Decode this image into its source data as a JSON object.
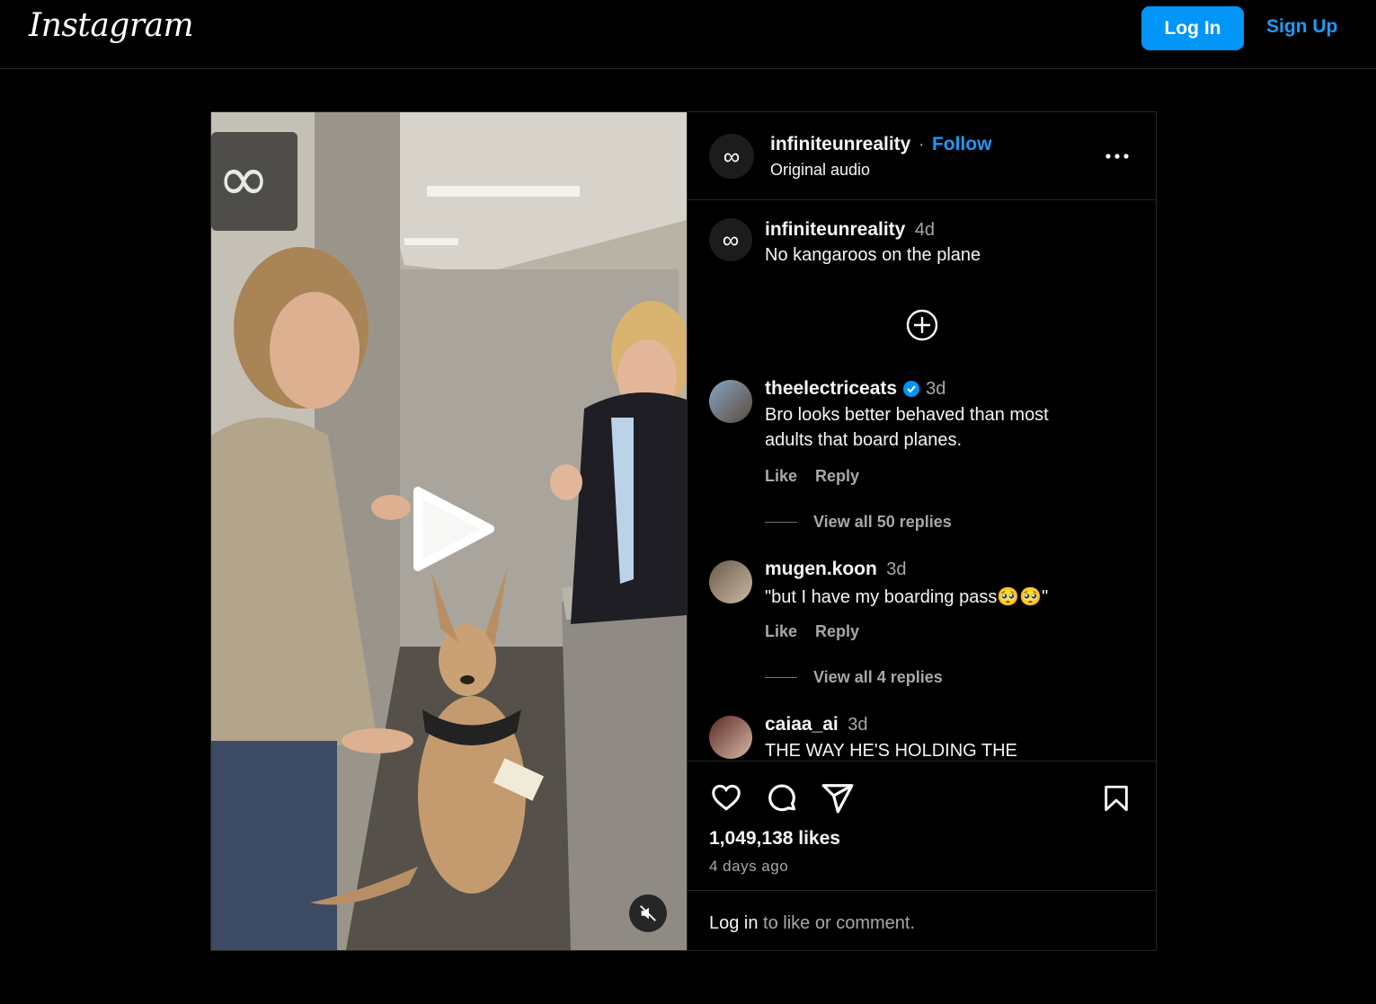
{
  "header": {
    "logo": "Instagram",
    "login_label": "Log In",
    "signup_label": "Sign Up"
  },
  "post": {
    "author": "infiniteunreality",
    "follow_label": "Follow",
    "separator": "·",
    "audio": "Original audio",
    "more_icon": "more-horizontal-icon",
    "caption": {
      "username": "infiniteunreality",
      "age": "4d",
      "text": "No kangaroos on the plane"
    },
    "comments": [
      {
        "username": "theelectriceats",
        "verified": true,
        "age": "3d",
        "text_line1": "Bro looks better behaved than most",
        "text_line2": "adults that board planes.",
        "like_label": "Like",
        "reply_label": "Reply",
        "view_replies": "View all 50 replies"
      },
      {
        "username": "mugen.koon",
        "verified": false,
        "age": "3d",
        "text_line1": "\"but I have my boarding pass🥺🥺\"",
        "like_label": "Like",
        "reply_label": "Reply",
        "view_replies": "View all 4 replies"
      },
      {
        "username": "caiaa_ai",
        "verified": false,
        "age": "3d",
        "text_line1": "THE WAY HE'S HOLDING THE"
      }
    ],
    "likes": "1,049,138 likes",
    "posted": "4 days ago",
    "login_prompt_link": "Log in",
    "login_prompt_rest": " to like or comment."
  },
  "colors": {
    "accent": "#0095f6",
    "follow": "#1a9bf7",
    "verified": "#0095f6",
    "background": "#000000"
  }
}
